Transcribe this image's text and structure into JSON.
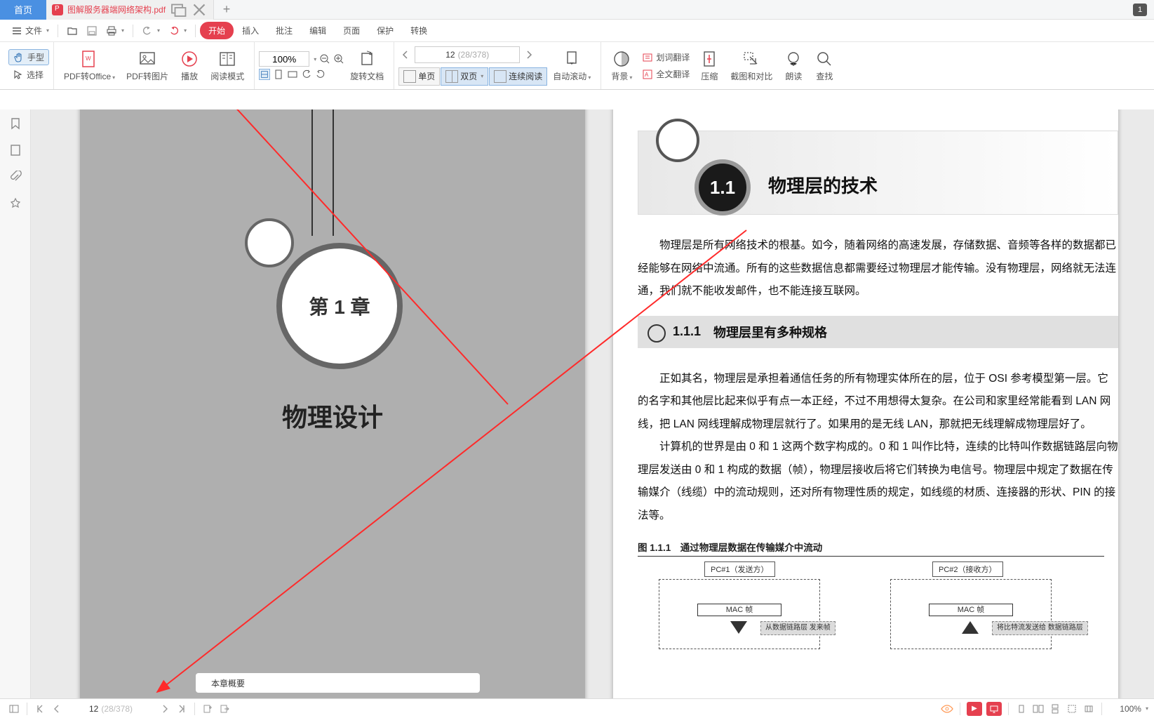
{
  "titlebar": {
    "home": "首页",
    "doc_name": "图解服务器端网络架构.pdf",
    "badge": "1"
  },
  "quickbar": {
    "file": "文件"
  },
  "menu": {
    "start": "开始",
    "insert": "插入",
    "comment": "批注",
    "edit": "编辑",
    "page": "页面",
    "protect": "保护",
    "convert": "转换"
  },
  "ribbon": {
    "hand": "手型",
    "select": "选择",
    "pdf2office": "PDF转Office",
    "pdf2img": "PDF转图片",
    "play": "播放",
    "readmode": "阅读模式",
    "zoom_value": "100%",
    "rotate": "旋转文档",
    "single": "单页",
    "double": "双页",
    "continuous": "连续阅读",
    "page_current": "12",
    "page_total": "(28/378)",
    "autoscroll": "自动滚动",
    "background": "背景",
    "word_trans": "划词翻译",
    "full_trans": "全文翻译",
    "compress": "压缩",
    "crop_compare": "截图和对比",
    "read_aloud": "朗读",
    "find": "查找"
  },
  "left_page": {
    "chapter": "第 1 章",
    "title": "物理设计",
    "overview": "本章概要"
  },
  "right_page": {
    "section_num": "1.1",
    "section_title": "物理层的技术",
    "para1": "物理层是所有网络技术的根基。如今，随着网络的高速发展，存储数据、音频等各样的数据都已经能够在网络中流通。所有的这些数据信息都需要经过物理层才能传输。没有物理层，网络就无法连通，我们就不能收发邮件，也不能连接互联网。",
    "sub_num": "1.1.1",
    "sub_title": "物理层里有多种规格",
    "para2": "正如其名，物理层是承担着通信任务的所有物理实体所在的层，位于 OSI 参考模型第一层。它的名字和其他层比起来似乎有点一本正经，不过不用想得太复杂。在公司和家里经常能看到 LAN 网线，把 LAN 网线理解成物理层就行了。如果用的是无线 LAN，那就把无线理解成物理层好了。",
    "para3": "计算机的世界是由 0 和 1 这两个数字构成的。0 和 1 叫作比特，连续的比特叫作数据链路层向物理层发送由 0 和 1 构成的数据（帧），物理层接收后将它们转换为电信号。物理层中规定了数据在传输媒介（线缆）中的流动规则，还对所有物理性质的规定，如线缆的材质、连接器的形状、PIN 的接法等。",
    "fig_caption": "图 1.1.1　通过物理层数据在传输媒介中流动",
    "pc1": "PC#1（发送方）",
    "pc2": "PC#2（接收方）",
    "mac": "MAC 帧",
    "note1": "从数据链路层\n发来帧",
    "note2": "将比特流发送给\n数据链路层"
  },
  "statusbar": {
    "page_current": "12",
    "page_total": "(28/378)",
    "zoom": "100%"
  }
}
